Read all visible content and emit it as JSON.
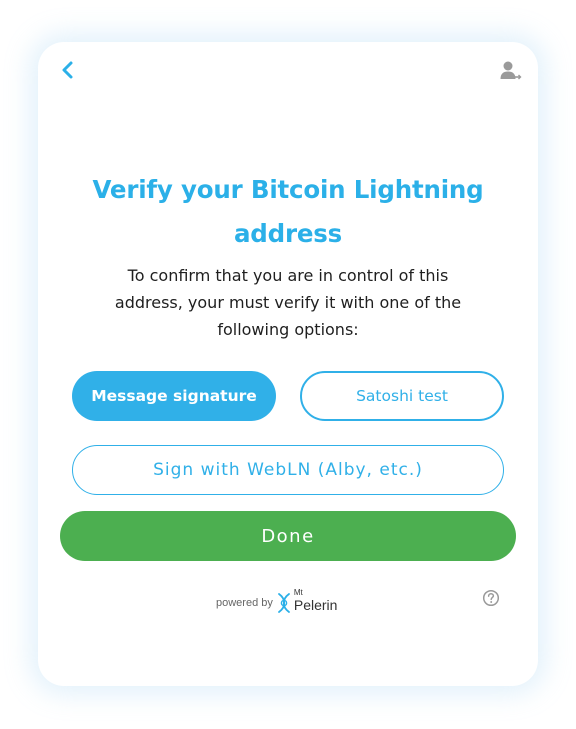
{
  "header": {
    "back_icon": "chevron-left-icon",
    "account_icon": "user-logout-icon"
  },
  "main": {
    "title": "Verify your Bitcoin Lightning address",
    "description": "To confirm that you are in control of this address, your must verify it with one of the following options:",
    "buttons": {
      "message_signature": "Message signature",
      "satoshi_test": "Satoshi test",
      "webln": "Sign with WebLN (Alby, etc.)",
      "done": "Done"
    }
  },
  "footer": {
    "powered_by": "powered by",
    "brand_prefix": "Mt",
    "brand_name": "Pelerin",
    "help_icon": "question-circle-icon"
  },
  "colors": {
    "accent": "#2bb0e8",
    "success": "#4caf50",
    "text": "#1f1f1f"
  }
}
